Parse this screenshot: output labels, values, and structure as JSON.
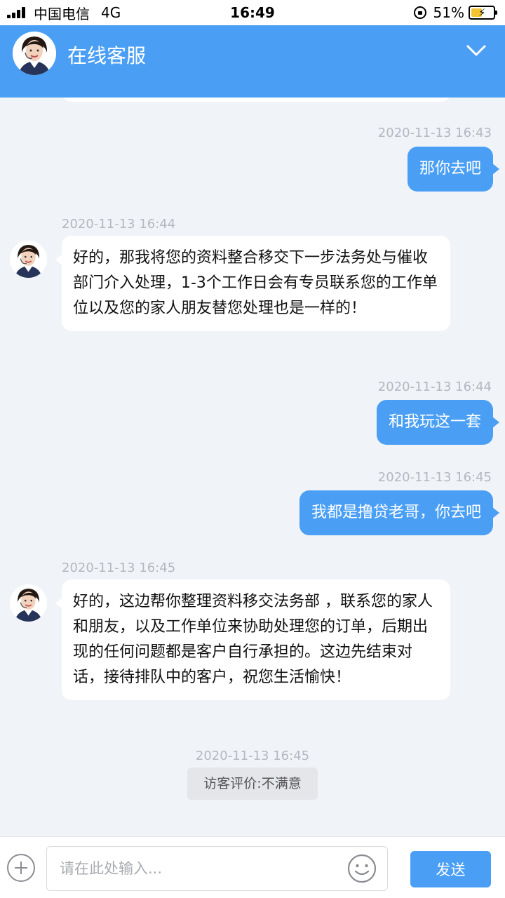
{
  "status_bar": {
    "carrier": "中国电信",
    "network": "4G",
    "time": "16:49",
    "battery_percent": "51%",
    "battery_level": 0.51
  },
  "header": {
    "title": "在线客服"
  },
  "messages": [
    {
      "from": "user",
      "time": "2020-11-13 16:43",
      "text": "那你去吧"
    },
    {
      "from": "agent",
      "time": "2020-11-13 16:44",
      "text": "好的，那我将您的资料整合移交下一步法务处与催收部门介入处理，1-3个工作日会有专员联系您的工作单位以及您的家人朋友替您处理也是一样的！"
    },
    {
      "from": "user",
      "time": "2020-11-13 16:44",
      "text": "和我玩这一套"
    },
    {
      "from": "user",
      "time": "2020-11-13 16:45",
      "text": "我都是撸贷老哥，你去吧"
    },
    {
      "from": "agent",
      "time": "2020-11-13 16:45",
      "text": "好的，这边帮你整理资料移交法务部 ，联系您的家人和朋友，以及工作单位来协助处理您的订单，后期出现的任何问题都是客户自行承担的。这边先结束对话，接待排队中的客户，祝您生活愉快！"
    }
  ],
  "rating": {
    "time": "2020-11-13 16:45",
    "text": "访客评价:不满意"
  },
  "input": {
    "placeholder": "请在此处输入...",
    "value": "",
    "send_label": "发送"
  },
  "colors": {
    "accent": "#4a9ff5",
    "background": "#f0f3f8",
    "bubble_agent": "#ffffff",
    "timestamp": "#b4b8bf"
  },
  "icons": {
    "header_avatar": "agent-avatar",
    "header_toggle": "chevron-down-icon",
    "attach": "plus-circle-icon",
    "emoji": "smiley-icon"
  }
}
